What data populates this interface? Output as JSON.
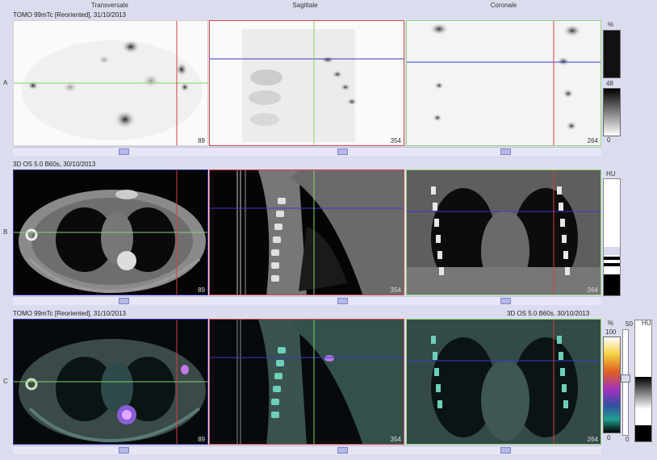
{
  "columns": {
    "transversal": "Transversale",
    "sagittal": "Sagittale",
    "coronal": "Coronale"
  },
  "rows": {
    "a": {
      "label": "A",
      "title": "TOMO 99mTc [Reoriented], 31/10/2013"
    },
    "b": {
      "label": "B",
      "title": "3D  OS  5.0  B60s, 30/10/2013"
    },
    "c": {
      "label": "C",
      "title": "TOMO 99mTc [Reoriented], 31/10/2013",
      "title_right": "3D  OS  5.0  B60s, 30/10/2013"
    }
  },
  "slices": {
    "a1": "89",
    "a2": "354",
    "a3": "264",
    "b1": "89",
    "b2": "354",
    "b3": "264",
    "c1": "89",
    "c2": "354",
    "c3": "264"
  },
  "scales": {
    "a": {
      "unit": "%",
      "mid": "48",
      "low": "0"
    },
    "b": {
      "unit": "HU"
    },
    "c": {
      "unit": "%",
      "high": "100",
      "low": "0",
      "fusion_high": "50",
      "fusion_low": "0",
      "fusion_unit": "HU"
    }
  },
  "colors": {
    "crosshair_h_tomo": "#3a3ac8",
    "crosshair_v_tomo": "#7ed66a",
    "crosshair_ct": "#d83c3c",
    "frame_green": "#8fd67a",
    "frame_red": "#d04a4a",
    "frame_blue": "#3838a8"
  }
}
